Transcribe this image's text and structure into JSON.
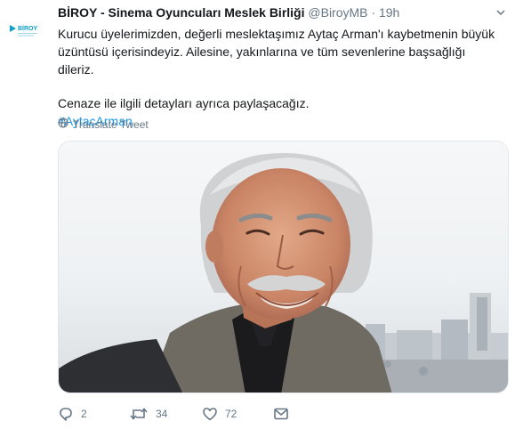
{
  "author": {
    "name": "BİROY - Sinema Oyuncuları Meslek Birliği",
    "handle": "@BiroyMB",
    "separator": "·",
    "time": "19h",
    "logo_text": "BİROY"
  },
  "tweet": {
    "paragraph_1": "Kurucu üyelerimizden, değerli meslektaşımız Aytaç Arman'ı kaybetmenin büyük üzüntüsü içerisindeyiz. Ailesine, yakınlarına ve tüm sevenlerine başsağlığı dileriz.",
    "paragraph_2": "Cenaze ile ilgili detayları ayrıca paylaşacağız.",
    "hashtag": "#AytaçArman",
    "translate_label": "Translate Tweet"
  },
  "actions": {
    "reply_count": "2",
    "retweet_count": "34",
    "like_count": "72"
  },
  "colors": {
    "text": "#14171a",
    "muted": "#657786",
    "link": "#1b95e0",
    "logo": "#0aa2c8"
  },
  "icons": [
    "chevron-down-icon",
    "globe-icon",
    "reply-icon",
    "retweet-icon",
    "like-icon",
    "message-icon"
  ]
}
